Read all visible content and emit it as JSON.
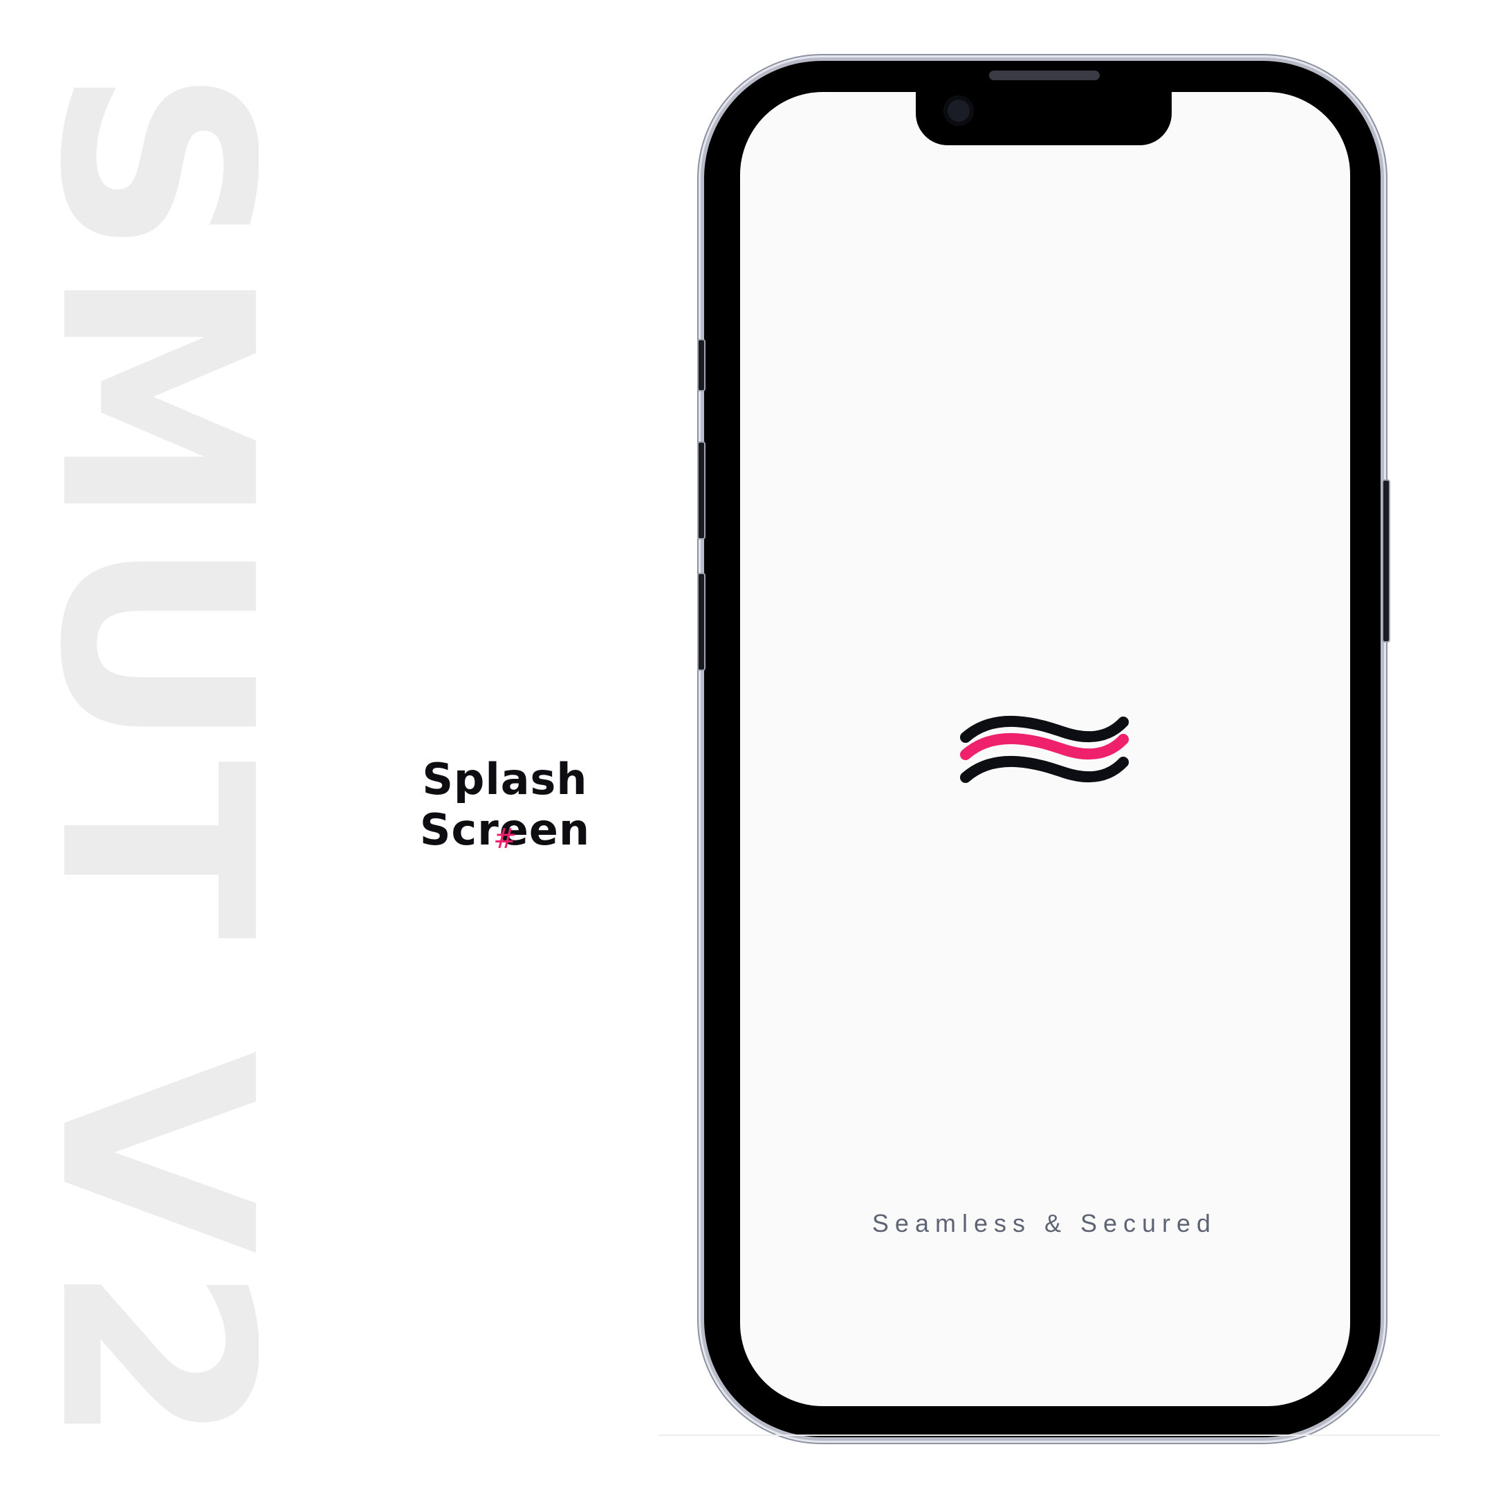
{
  "watermark": {
    "text": "SMUT V2"
  },
  "caption": {
    "title": "Splash Screen",
    "hash": "#"
  },
  "phone": {
    "screen": {
      "background": "#fafafa",
      "logo": {
        "name": "wave-logo-icon",
        "outer_color": "#0d0d14",
        "accent_color": "#f0216c"
      },
      "tagline": "Seamless & Secured"
    }
  },
  "colors": {
    "accent": "#ef1f6b",
    "title": "#0d0d12",
    "watermark": "#ececec",
    "tagline": "#5f6474"
  }
}
